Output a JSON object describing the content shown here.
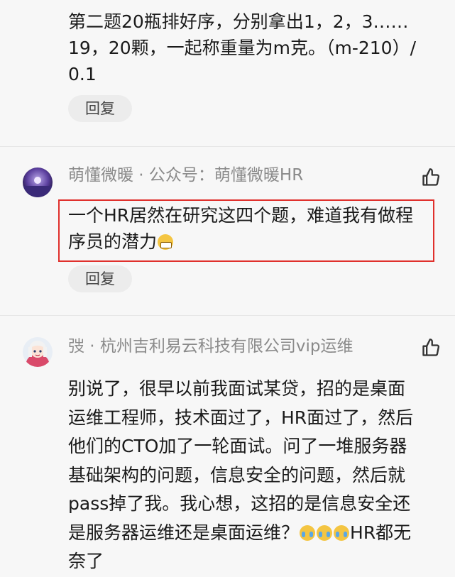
{
  "comments": [
    {
      "content_lines": [
        "第二题20瓶排好序，分别拿出1，2，3……",
        "19，20颗，一起称重量为m克。（m-210）/",
        "0.1"
      ],
      "reply_label": "回复"
    },
    {
      "author": "萌懂微暖 · 公众号：萌懂微暖HR",
      "avatar_icon": "purple-night-avatar",
      "content_lines": [
        "一个HR居然在研究这四个题，难道我有做程",
        "序员的潜力"
      ],
      "content_emoji": "grin-emoji",
      "reply_label": "回复",
      "highlight_color": "#e0302c"
    },
    {
      "author": "弢 · 杭州吉利易云科技有限公司vip运维",
      "avatar_icon": "cartoon-girl-avatar",
      "content_lines": [
        "别说了，很早以前我面试某贷，招的是桌面",
        "运维工程师，技术面过了，HR面过了，然后",
        "他们的CTO加了一轮面试。问了一堆服务器",
        "基础架构的问题，信息安全的问题，然后就",
        "pass掉了我。我心想，这招的是信息安全还",
        "是服务器运维还是桌面运维？",
        "HR都无",
        "奈了"
      ],
      "content_emojis": [
        "cry-emoji",
        "cry-emoji",
        "cry-emoji"
      ]
    }
  ],
  "colors": {
    "background": "#f7f7f7",
    "author_gray": "#8a8a8a",
    "reply_bg": "#ececec",
    "highlight_red": "#e0302c"
  }
}
